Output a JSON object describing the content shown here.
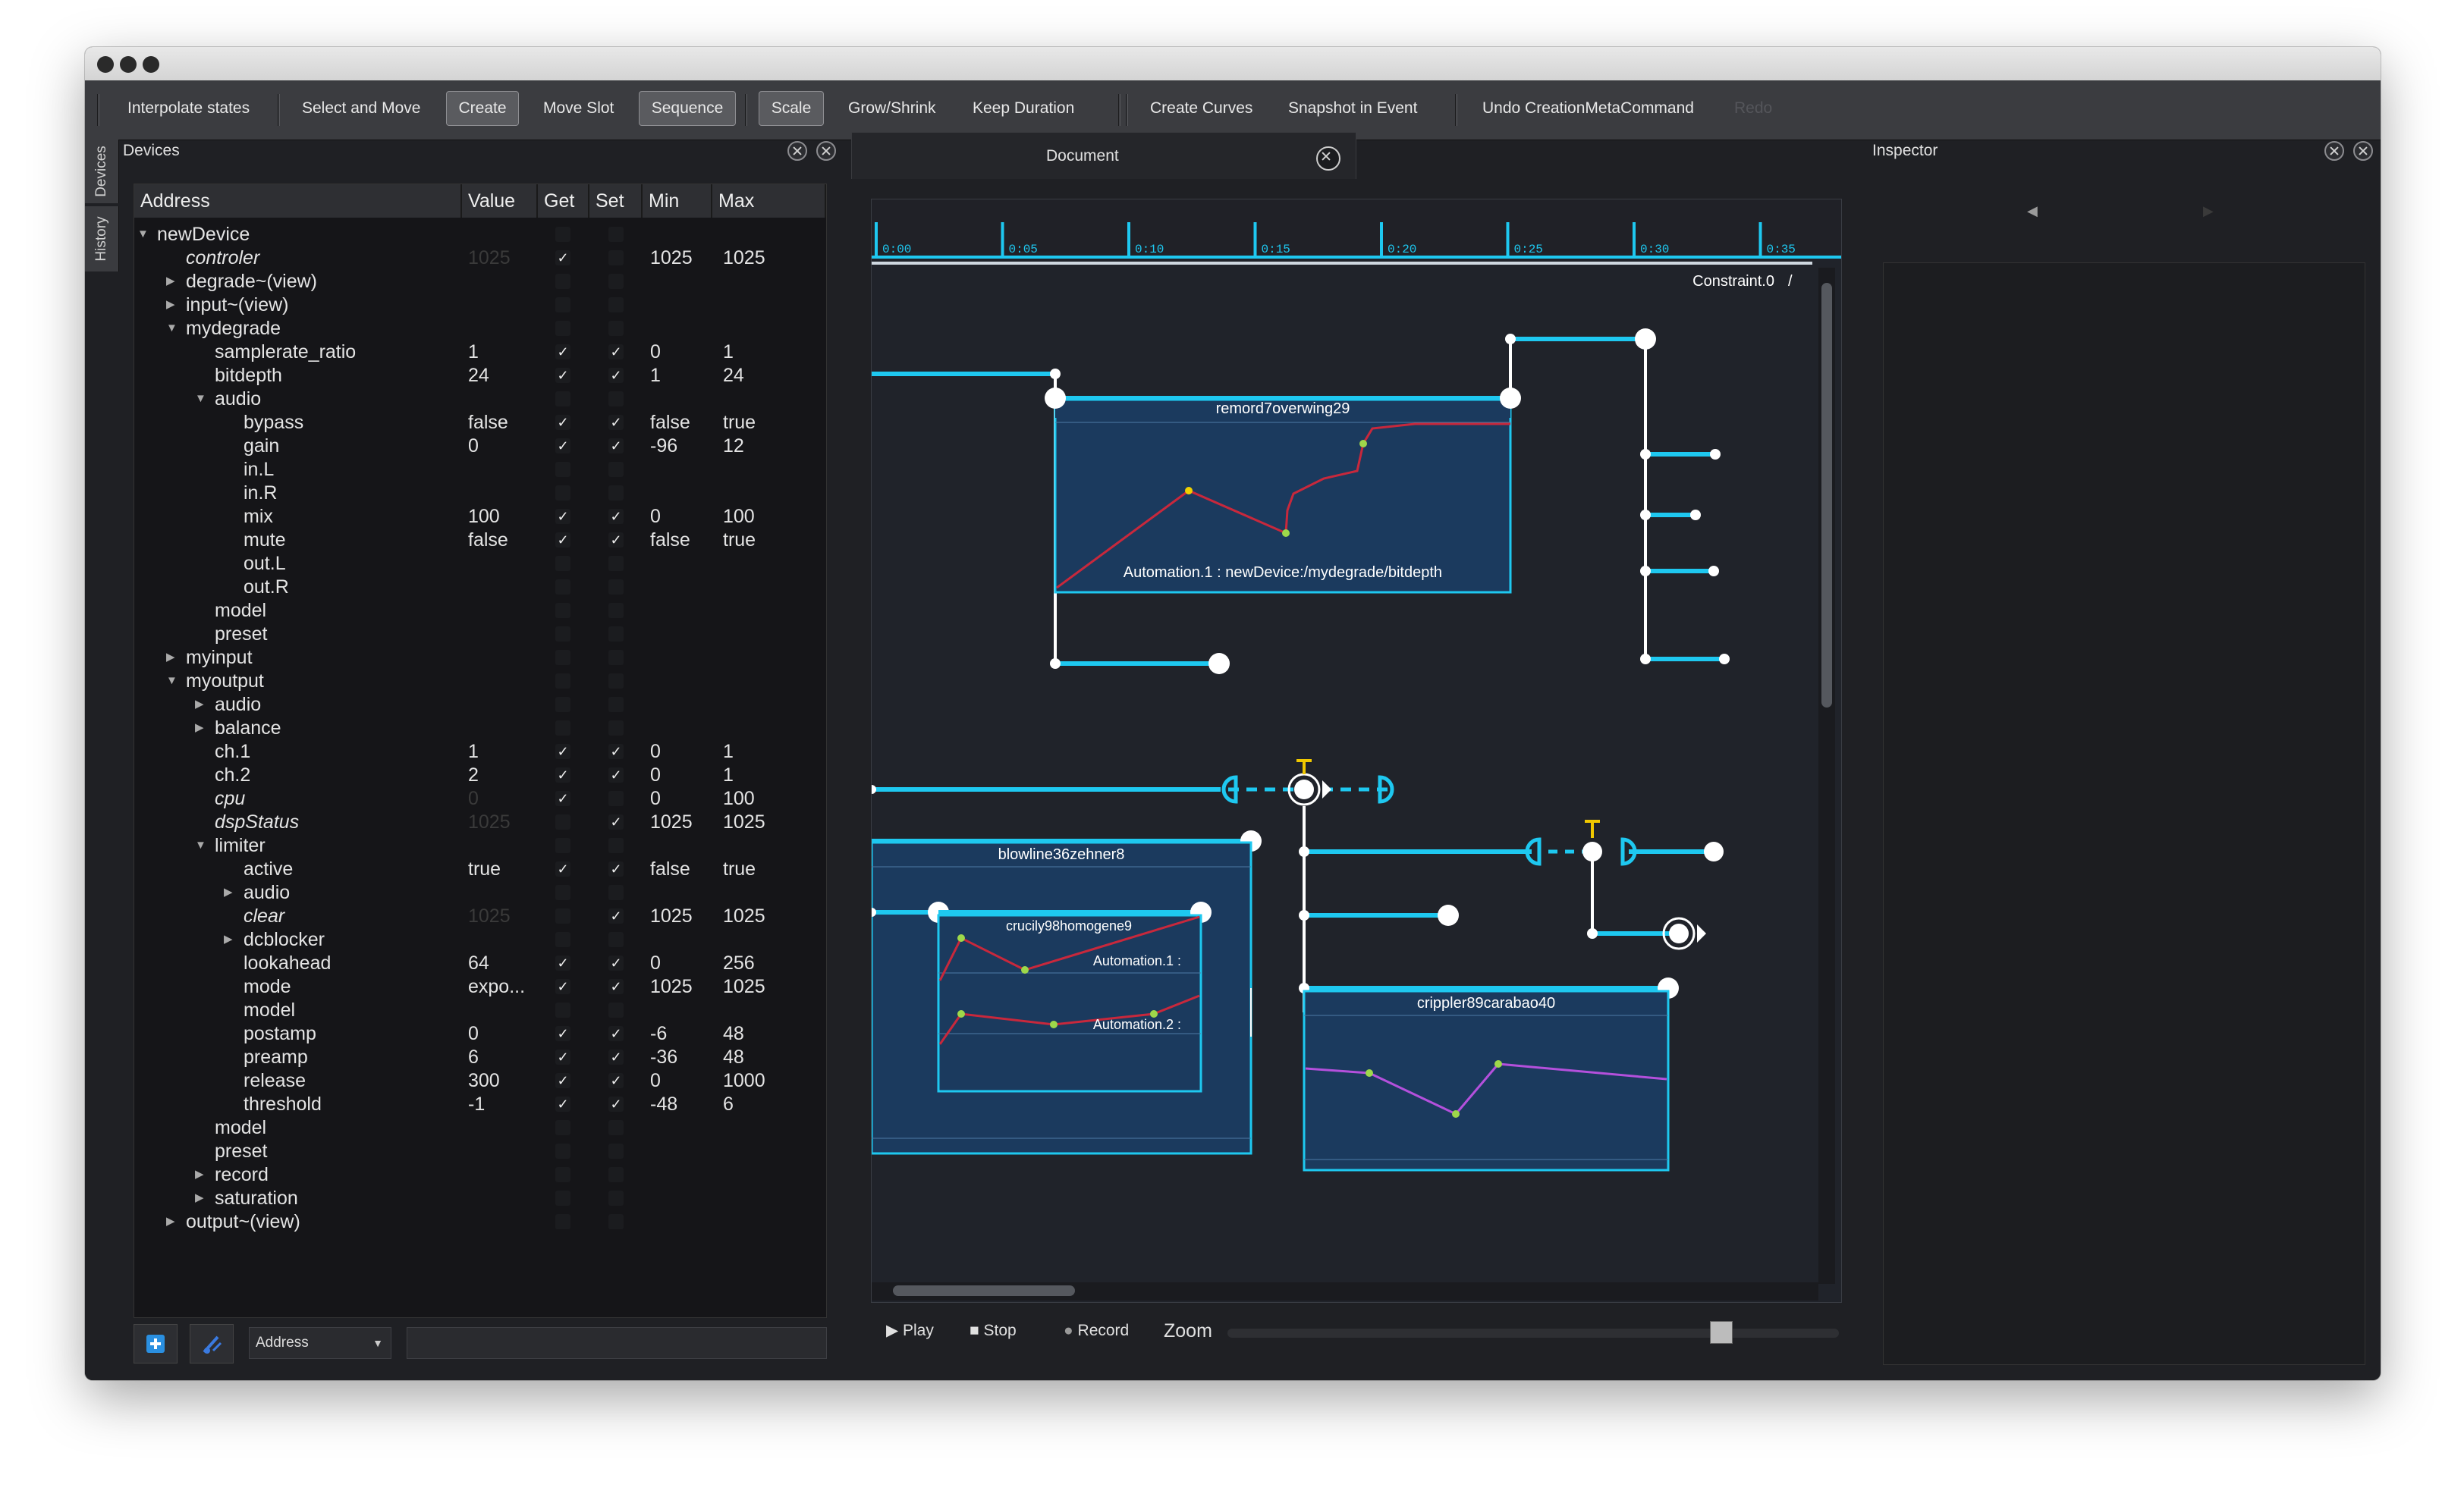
{
  "window": {
    "title": ""
  },
  "toolbar": {
    "interpolate": "Interpolate states",
    "select_move": "Select and Move",
    "create": "Create",
    "move_slot": "Move Slot",
    "sequence": "Sequence",
    "scale": "Scale",
    "grow_shrink": "Grow/Shrink",
    "keep_duration": "Keep Duration",
    "create_curves": "Create Curves",
    "snapshot": "Snapshot in Event",
    "undo": "Undo CreationMetaCommand",
    "redo": "Redo"
  },
  "sidetabs": {
    "devices": "Devices",
    "history": "History"
  },
  "devices_panel": {
    "title": "Devices",
    "columns": [
      "Address",
      "Value",
      "Get",
      "Set",
      "Min",
      "Max"
    ],
    "rows": [
      {
        "label": "newDevice",
        "depth": 0,
        "arrow": "down",
        "italic": false,
        "value": "",
        "dim": false,
        "get": "",
        "set": "",
        "min": "",
        "max": ""
      },
      {
        "label": "controler",
        "depth": 1,
        "arrow": "",
        "italic": true,
        "value": "1025",
        "dim": true,
        "get": "✓",
        "set": "",
        "min": "1025",
        "max": "1025"
      },
      {
        "label": "degrade~(view)",
        "depth": 1,
        "arrow": "right",
        "italic": false,
        "value": "",
        "dim": false,
        "get": "",
        "set": "",
        "min": "",
        "max": ""
      },
      {
        "label": "input~(view)",
        "depth": 1,
        "arrow": "right",
        "italic": false,
        "value": "",
        "dim": false,
        "get": "",
        "set": "",
        "min": "",
        "max": ""
      },
      {
        "label": "mydegrade",
        "depth": 1,
        "arrow": "down",
        "italic": false,
        "value": "",
        "dim": false,
        "get": "",
        "set": "",
        "min": "",
        "max": ""
      },
      {
        "label": "samplerate_ratio",
        "depth": 2,
        "arrow": "",
        "italic": false,
        "value": "1",
        "dim": false,
        "get": "✓",
        "set": "✓",
        "min": "0",
        "max": "1"
      },
      {
        "label": "bitdepth",
        "depth": 2,
        "arrow": "",
        "italic": false,
        "value": "24",
        "dim": false,
        "get": "✓",
        "set": "✓",
        "min": "1",
        "max": "24"
      },
      {
        "label": "audio",
        "depth": 2,
        "arrow": "down",
        "italic": false,
        "value": "",
        "dim": false,
        "get": "",
        "set": "",
        "min": "",
        "max": ""
      },
      {
        "label": "bypass",
        "depth": 3,
        "arrow": "",
        "italic": false,
        "value": "false",
        "dim": false,
        "get": "✓",
        "set": "✓",
        "min": "false",
        "max": "true"
      },
      {
        "label": "gain",
        "depth": 3,
        "arrow": "",
        "italic": false,
        "value": "0",
        "dim": false,
        "get": "✓",
        "set": "✓",
        "min": "-96",
        "max": "12"
      },
      {
        "label": "in.L",
        "depth": 3,
        "arrow": "",
        "italic": false,
        "value": "",
        "dim": false,
        "get": "",
        "set": "",
        "min": "",
        "max": ""
      },
      {
        "label": "in.R",
        "depth": 3,
        "arrow": "",
        "italic": false,
        "value": "",
        "dim": false,
        "get": "",
        "set": "",
        "min": "",
        "max": ""
      },
      {
        "label": "mix",
        "depth": 3,
        "arrow": "",
        "italic": false,
        "value": "100",
        "dim": false,
        "get": "✓",
        "set": "✓",
        "min": "0",
        "max": "100"
      },
      {
        "label": "mute",
        "depth": 3,
        "arrow": "",
        "italic": false,
        "value": "false",
        "dim": false,
        "get": "✓",
        "set": "✓",
        "min": "false",
        "max": "true"
      },
      {
        "label": "out.L",
        "depth": 3,
        "arrow": "",
        "italic": false,
        "value": "",
        "dim": false,
        "get": "",
        "set": "",
        "min": "",
        "max": ""
      },
      {
        "label": "out.R",
        "depth": 3,
        "arrow": "",
        "italic": false,
        "value": "",
        "dim": false,
        "get": "",
        "set": "",
        "min": "",
        "max": ""
      },
      {
        "label": "model",
        "depth": 2,
        "arrow": "",
        "italic": false,
        "value": "",
        "dim": false,
        "get": "",
        "set": "",
        "min": "",
        "max": ""
      },
      {
        "label": "preset",
        "depth": 2,
        "arrow": "",
        "italic": false,
        "value": "",
        "dim": false,
        "get": "",
        "set": "",
        "min": "",
        "max": ""
      },
      {
        "label": "myinput",
        "depth": 1,
        "arrow": "right",
        "italic": false,
        "value": "",
        "dim": false,
        "get": "",
        "set": "",
        "min": "",
        "max": ""
      },
      {
        "label": "myoutput",
        "depth": 1,
        "arrow": "down",
        "italic": false,
        "value": "",
        "dim": false,
        "get": "",
        "set": "",
        "min": "",
        "max": ""
      },
      {
        "label": "audio",
        "depth": 2,
        "arrow": "right",
        "italic": false,
        "value": "",
        "dim": false,
        "get": "",
        "set": "",
        "min": "",
        "max": ""
      },
      {
        "label": "balance",
        "depth": 2,
        "arrow": "right",
        "italic": false,
        "value": "",
        "dim": false,
        "get": "",
        "set": "",
        "min": "",
        "max": ""
      },
      {
        "label": "ch.1",
        "depth": 2,
        "arrow": "",
        "italic": false,
        "value": "1",
        "dim": false,
        "get": "✓",
        "set": "✓",
        "min": "0",
        "max": "1"
      },
      {
        "label": "ch.2",
        "depth": 2,
        "arrow": "",
        "italic": false,
        "value": "2",
        "dim": false,
        "get": "✓",
        "set": "✓",
        "min": "0",
        "max": "1"
      },
      {
        "label": "cpu",
        "depth": 2,
        "arrow": "",
        "italic": true,
        "value": "0",
        "dim": true,
        "get": "✓",
        "set": "",
        "min": "0",
        "max": "100"
      },
      {
        "label": "dspStatus",
        "depth": 2,
        "arrow": "",
        "italic": true,
        "value": "1025",
        "dim": true,
        "get": "",
        "set": "✓",
        "min": "1025",
        "max": "1025"
      },
      {
        "label": "limiter",
        "depth": 2,
        "arrow": "down",
        "italic": false,
        "value": "",
        "dim": false,
        "get": "",
        "set": "",
        "min": "",
        "max": ""
      },
      {
        "label": "active",
        "depth": 3,
        "arrow": "",
        "italic": false,
        "value": "true",
        "dim": false,
        "get": "✓",
        "set": "✓",
        "min": "false",
        "max": "true"
      },
      {
        "label": "audio",
        "depth": 3,
        "arrow": "right",
        "italic": false,
        "value": "",
        "dim": false,
        "get": "",
        "set": "",
        "min": "",
        "max": ""
      },
      {
        "label": "clear",
        "depth": 3,
        "arrow": "",
        "italic": true,
        "value": "1025",
        "dim": true,
        "get": "",
        "set": "✓",
        "min": "1025",
        "max": "1025"
      },
      {
        "label": "dcblocker",
        "depth": 3,
        "arrow": "right",
        "italic": false,
        "value": "",
        "dim": false,
        "get": "",
        "set": "",
        "min": "",
        "max": ""
      },
      {
        "label": "lookahead",
        "depth": 3,
        "arrow": "",
        "italic": false,
        "value": "64",
        "dim": false,
        "get": "✓",
        "set": "✓",
        "min": "0",
        "max": "256"
      },
      {
        "label": "mode",
        "depth": 3,
        "arrow": "",
        "italic": false,
        "value": "expo...",
        "dim": false,
        "get": "✓",
        "set": "✓",
        "min": "1025",
        "max": "1025"
      },
      {
        "label": "model",
        "depth": 3,
        "arrow": "",
        "italic": false,
        "value": "",
        "dim": false,
        "get": "",
        "set": "",
        "min": "",
        "max": ""
      },
      {
        "label": "postamp",
        "depth": 3,
        "arrow": "",
        "italic": false,
        "value": "0",
        "dim": false,
        "get": "✓",
        "set": "✓",
        "min": "-6",
        "max": "48"
      },
      {
        "label": "preamp",
        "depth": 3,
        "arrow": "",
        "italic": false,
        "value": "6",
        "dim": false,
        "get": "✓",
        "set": "✓",
        "min": "-36",
        "max": "48"
      },
      {
        "label": "release",
        "depth": 3,
        "arrow": "",
        "italic": false,
        "value": "300",
        "dim": false,
        "get": "✓",
        "set": "✓",
        "min": "0",
        "max": "1000"
      },
      {
        "label": "threshold",
        "depth": 3,
        "arrow": "",
        "italic": false,
        "value": "-1",
        "dim": false,
        "get": "✓",
        "set": "✓",
        "min": "-48",
        "max": "6"
      },
      {
        "label": "model",
        "depth": 2,
        "arrow": "",
        "italic": false,
        "value": "",
        "dim": false,
        "get": "",
        "set": "",
        "min": "",
        "max": ""
      },
      {
        "label": "preset",
        "depth": 2,
        "arrow": "",
        "italic": false,
        "value": "",
        "dim": false,
        "get": "",
        "set": "",
        "min": "",
        "max": ""
      },
      {
        "label": "record",
        "depth": 2,
        "arrow": "right",
        "italic": false,
        "value": "",
        "dim": false,
        "get": "",
        "set": "",
        "min": "",
        "max": ""
      },
      {
        "label": "saturation",
        "depth": 2,
        "arrow": "right",
        "italic": false,
        "value": "",
        "dim": false,
        "get": "",
        "set": "",
        "min": "",
        "max": ""
      },
      {
        "label": "output~(view)",
        "depth": 1,
        "arrow": "right",
        "italic": false,
        "value": "",
        "dim": false,
        "get": "",
        "set": "",
        "min": "",
        "max": ""
      }
    ],
    "bottom": {
      "address_select": "Address",
      "filter_value": ""
    }
  },
  "document": {
    "tab_title": "Document",
    "ruler": [
      "0:00",
      "0:05",
      "0:10",
      "0:15",
      "0:20",
      "0:25",
      "0:30",
      "0:35"
    ],
    "constraint_label": "Constraint.0",
    "constraint_suffix": "/",
    "boxes": {
      "remord": "remord7overwing29",
      "remord_auto": "Automation.1 : newDevice:/mydegrade/bitdepth",
      "blowline": "blowline36zehner8",
      "crucily": "crucily98homogene9",
      "crucily_auto1": "Automation.1 :",
      "crucily_auto2": "Automation.2 :",
      "crippler": "crippler89carabao40"
    },
    "transport": {
      "play": "Play",
      "stop": "Stop",
      "record": "Record",
      "zoom": "Zoom"
    },
    "zoom_level": 0.82
  },
  "inspector": {
    "title": "Inspector"
  },
  "colors": {
    "accent": "#1ec8f0",
    "curve_red": "#c8283c",
    "curve_purple": "#b450dc",
    "box_fill": "#1b3a5e",
    "trigger": "#f0c800"
  }
}
